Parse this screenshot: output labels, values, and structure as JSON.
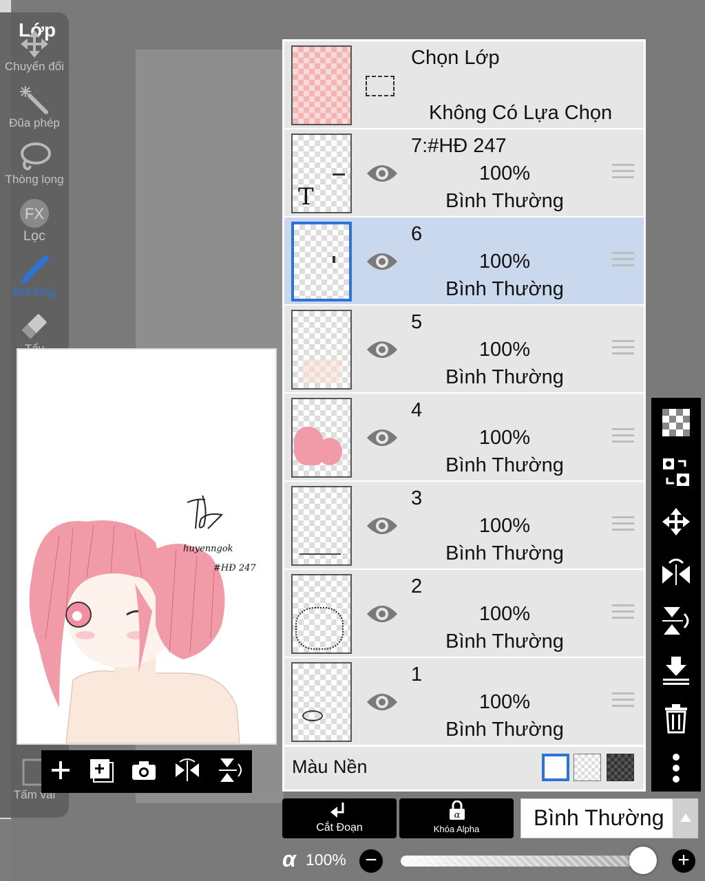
{
  "toolbar": {
    "title": "Lớp",
    "tools": [
      {
        "label": "Chuyển đổi",
        "icon": "move-arrows-icon"
      },
      {
        "label": "Đũa phép",
        "icon": "magic-wand-icon"
      },
      {
        "label": "Thòng lọng",
        "icon": "lasso-icon"
      },
      {
        "label": "Lọc",
        "icon": "fx-filter-icon"
      },
      {
        "label": "Bút lông",
        "icon": "brush-icon"
      },
      {
        "label": "Tẩy",
        "icon": "eraser-icon"
      }
    ],
    "canvas_label": "Tấm vải"
  },
  "preview": {
    "signature": "huyenngok",
    "tag": "#HĐ 247"
  },
  "layers": {
    "selection": {
      "title": "Chọn Lớp",
      "status": "Không Có Lựa Chọn"
    },
    "items": [
      {
        "name": "7:#HĐ 247",
        "opacity": "100%",
        "mode": "Bình Thường",
        "type_glyph": "T"
      },
      {
        "name": "6",
        "opacity": "100%",
        "mode": "Bình Thường"
      },
      {
        "name": "5",
        "opacity": "100%",
        "mode": "Bình Thường"
      },
      {
        "name": "4",
        "opacity": "100%",
        "mode": "Bình Thường"
      },
      {
        "name": "3",
        "opacity": "100%",
        "mode": "Bình Thường"
      },
      {
        "name": "2",
        "opacity": "100%",
        "mode": "Bình Thường"
      },
      {
        "name": "1",
        "opacity": "100%",
        "mode": "Bình Thường"
      }
    ],
    "selected_index": 1,
    "background_label": "Màu Nền"
  },
  "bottom": {
    "clip_label": "Cắt Đoạn",
    "alpha_lock_label": "Khóa Alpha",
    "blend_mode": "Bình Thường",
    "alpha_symbol": "α",
    "opacity": "100%",
    "opacity_fraction": 1.0
  },
  "colors": {
    "accent": "#2b73d6",
    "selected_row": "#c9d8ec",
    "hair_pink": "#f19aa8"
  }
}
